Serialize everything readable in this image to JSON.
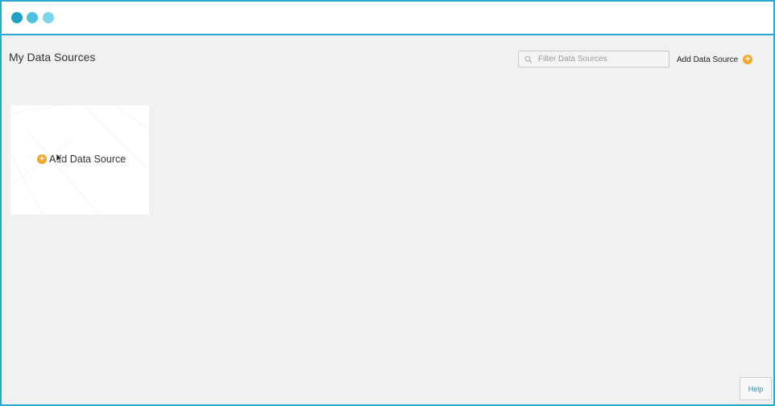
{
  "window": {
    "controls": [
      {
        "name": "traffic-dot-1",
        "color": "#1ea3c7"
      },
      {
        "name": "traffic-dot-2",
        "color": "#4cc2e0"
      },
      {
        "name": "traffic-dot-3",
        "color": "#7ed6ea"
      }
    ],
    "border_color": "#29a9cf"
  },
  "page": {
    "title": "My Data Sources"
  },
  "toolbar": {
    "filter_placeholder": "Filter Data Sources",
    "filter_value": "",
    "search_icon": "search-icon",
    "add_label": "Add Data Source",
    "add_icon": "plus-circle-icon",
    "accent_color": "#f5a623"
  },
  "grid": {
    "cards": [
      {
        "label": "Add Data Source",
        "icon": "plus-circle-icon"
      }
    ]
  },
  "help": {
    "label": "Help"
  }
}
